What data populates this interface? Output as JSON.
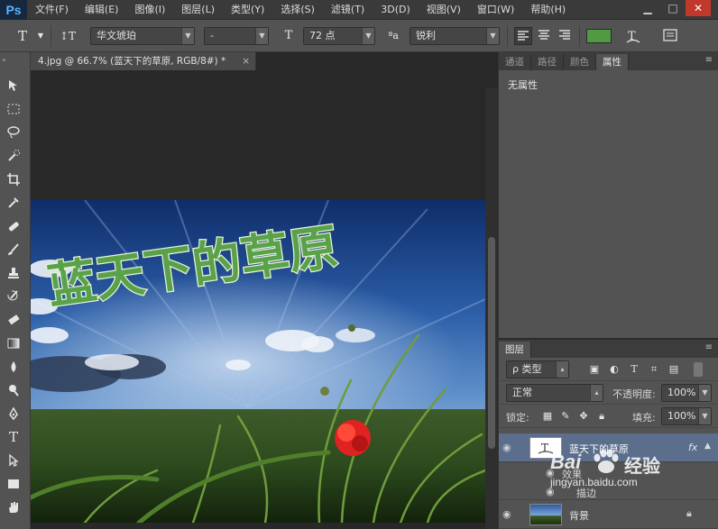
{
  "app": {
    "logo": "Ps"
  },
  "menu": [
    "文件(F)",
    "编辑(E)",
    "图像(I)",
    "图层(L)",
    "类型(Y)",
    "选择(S)",
    "滤镜(T)",
    "3D(D)",
    "视图(V)",
    "窗口(W)",
    "帮助(H)"
  ],
  "window_controls": {
    "minimize": "▁",
    "maximize": "□",
    "close": "✕"
  },
  "options": {
    "tool_glyph": "T",
    "orient_glyph": "↕T",
    "font_family": "华文琥珀",
    "font_style": "-",
    "size_glyph": "T",
    "font_size": "72 点",
    "aa_glyph": "ªa",
    "antialias": "锐利",
    "text_color": "#4f9a42"
  },
  "document": {
    "tab_title": "4.jpg @ 66.7% (蓝天下的草原, RGB/8#) *",
    "close": "×",
    "headline": "蓝天下的草原"
  },
  "properties_panel": {
    "tabs": [
      "通道",
      "路径",
      "颜色",
      "属性"
    ],
    "active_tab": "属性",
    "content": "无属性"
  },
  "layers_panel": {
    "tab": "图层",
    "filter_kind": "ρ 类型",
    "blend_mode": "正常",
    "opacity_label": "不透明度:",
    "opacity": "100%",
    "lock_label": "锁定:",
    "fill_label": "填充:",
    "fill": "100%",
    "layers": [
      {
        "name": "蓝天下的草原",
        "fx": "fx"
      },
      {
        "name": "背景"
      }
    ],
    "effects_label": "效果",
    "stroke_label": "描边"
  },
  "watermark": {
    "brand": "Bai",
    "brand2": "经验",
    "url": "jingyan.baidu.com"
  },
  "colors": {
    "accent": "#4f9a42",
    "selection": "#5b6e8c"
  }
}
